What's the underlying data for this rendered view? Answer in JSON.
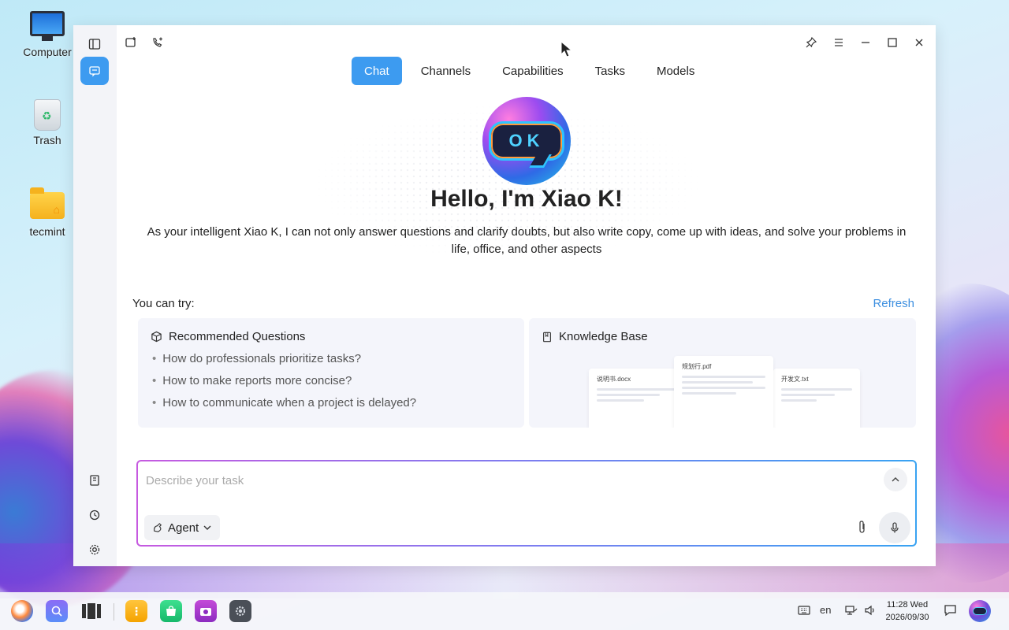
{
  "desktop": {
    "icons": [
      {
        "label": "Computer"
      },
      {
        "label": "Trash"
      },
      {
        "label": "tecmint"
      }
    ]
  },
  "window": {
    "tabs": [
      {
        "label": "Chat",
        "active": true
      },
      {
        "label": "Channels",
        "active": false
      },
      {
        "label": "Capabilities",
        "active": false
      },
      {
        "label": "Tasks",
        "active": false
      },
      {
        "label": "Models",
        "active": false
      }
    ],
    "greeting": "Hello, I'm Xiao K!",
    "intro": "As your intelligent Xiao K, I can not only answer questions and clarify doubts, but also write copy, come up with ideas, and solve your problems in life, office, and other aspects",
    "try_label": "You can try:",
    "refresh_label": "Refresh",
    "recommended": {
      "title": "Recommended Questions",
      "questions": [
        "How do professionals prioritize tasks?",
        "How to make reports more concise?",
        "How to communicate when a project is delayed?"
      ]
    },
    "knowledge_base": {
      "title": "Knowledge Base",
      "docs": [
        "说明书.docx",
        "规划行.pdf",
        "开发文.txt"
      ]
    },
    "input": {
      "placeholder": "Describe your task",
      "value": "",
      "mode_label": "Agent"
    }
  },
  "taskbar": {
    "language": "en",
    "time": "11:28 Wed",
    "date": "2026/09/30"
  },
  "colors": {
    "accent": "#3d9bf0",
    "refresh_link": "#3d8fe0",
    "sidebar_bg": "#f3f4f8",
    "card_bg": "#f4f5fb"
  }
}
